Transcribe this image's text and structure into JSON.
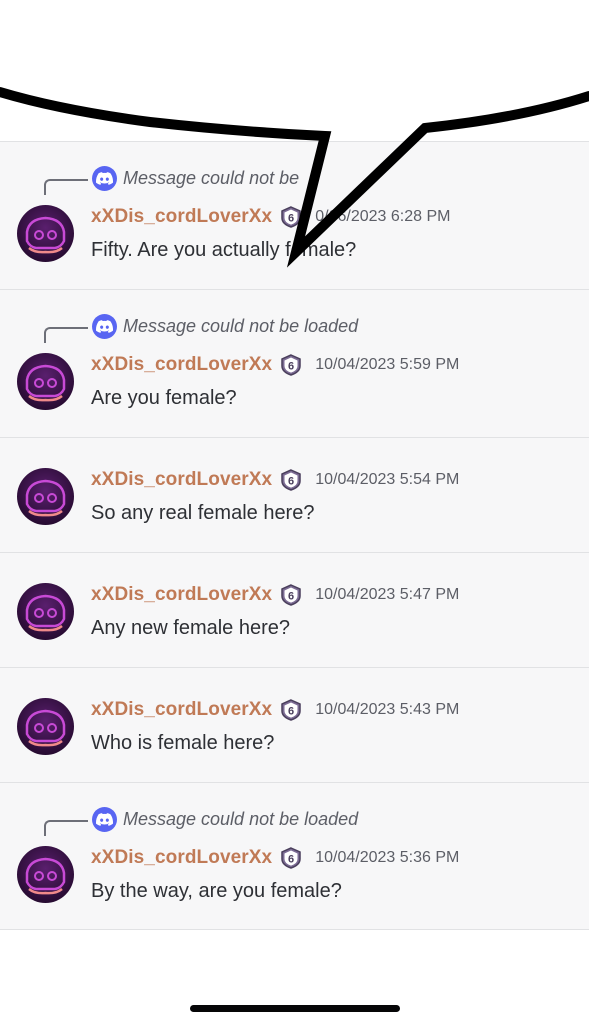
{
  "messages": [
    {
      "reply": "Message could not be loaded",
      "reply_visible": "Message could not be",
      "username": "xXDis_cordLoverXx",
      "badge": "6",
      "timestamp": "10/06/2023 6:28 PM",
      "timestamp_visible": "0/06/2023 6:28 PM",
      "content": "Fifty. Are you actually female?"
    },
    {
      "reply": "Message could not be loaded",
      "username": "xXDis_cordLoverXx",
      "badge": "6",
      "timestamp": "10/04/2023 5:59 PM",
      "content": "Are you female?"
    },
    {
      "username": "xXDis_cordLoverXx",
      "badge": "6",
      "timestamp": "10/04/2023 5:54 PM",
      "content": "So any real female here?"
    },
    {
      "username": "xXDis_cordLoverXx",
      "badge": "6",
      "timestamp": "10/04/2023 5:47 PM",
      "content": "Any new female here?"
    },
    {
      "username": "xXDis_cordLoverXx",
      "badge": "6",
      "timestamp": "10/04/2023 5:43 PM",
      "content": "Who is female here?"
    },
    {
      "reply": "Message could not be loaded",
      "username": "xXDis_cordLoverXx",
      "badge": "6",
      "timestamp": "10/04/2023 5:36 PM",
      "content": "By the way, are you female?"
    }
  ],
  "icons": {
    "reply_icon": "discord-logo-icon",
    "avatar": "discord-clyde-avatar",
    "badge": "server-level-shield-icon"
  },
  "colors": {
    "username": "#c07a56",
    "reply_icon_bg": "#5865f2",
    "message_bg": "#f7f7f8",
    "speech_bubble_stroke": "#000000"
  }
}
